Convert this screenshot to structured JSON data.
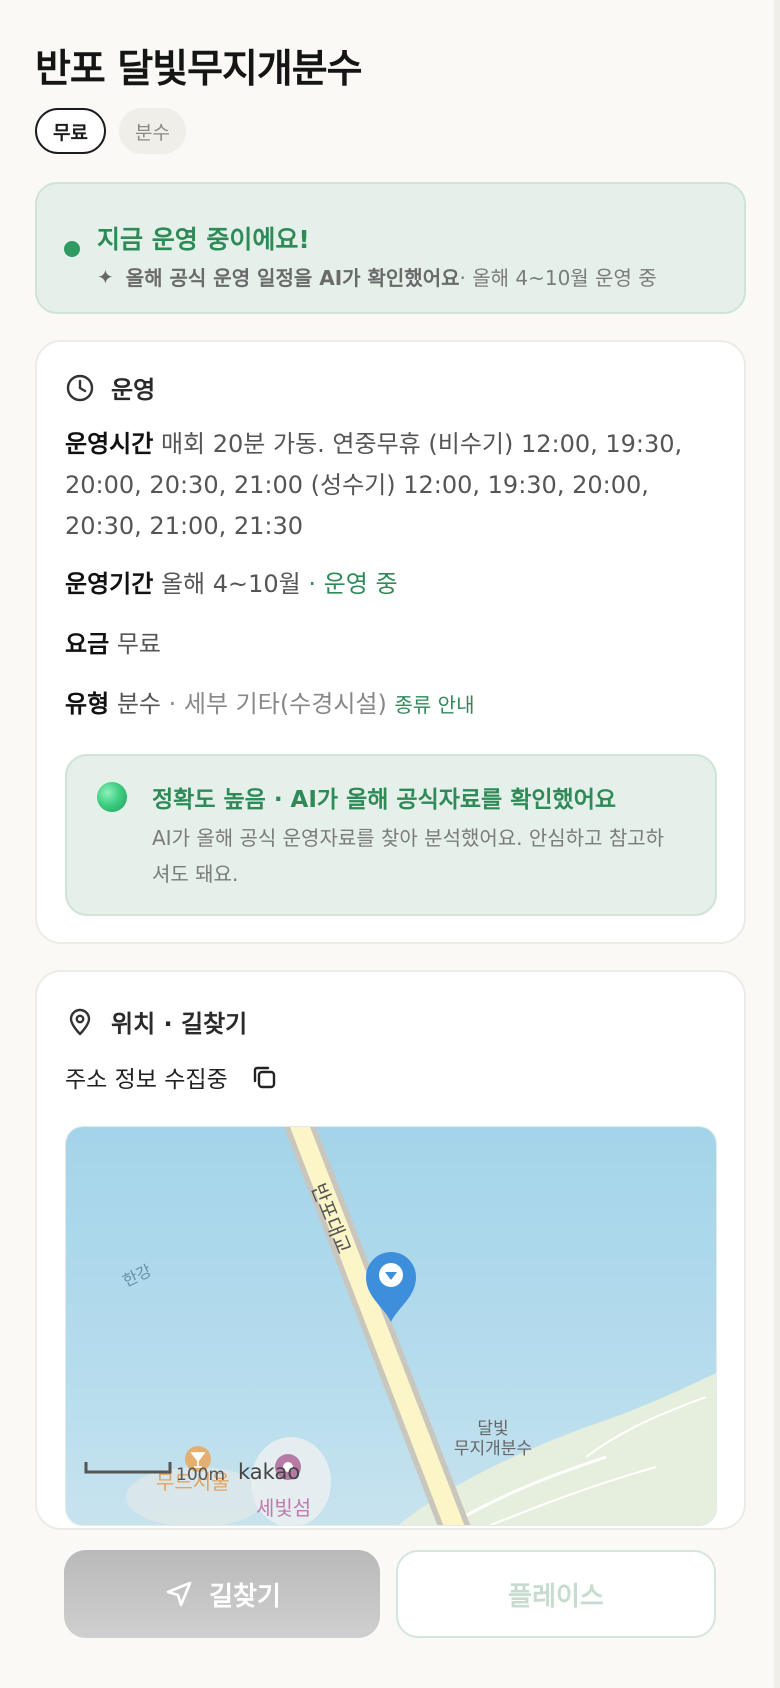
{
  "header": {
    "title": "반포 달빛무지개분수",
    "tags": [
      "무료",
      "분수"
    ]
  },
  "status": {
    "title": "지금 운영 중이에요!",
    "sub_bold": "올해 공식 운영 일정을 AI가 확인했어요",
    "sub_rest": " · 올해 4~10월 운영 중",
    "sparkle_icon": "sparkle-icon",
    "accent": "#2e8a57"
  },
  "operation": {
    "section_title": "운영",
    "hours_label": "운영시간",
    "hours_value": "매회 20분 가동. 연중무휴 (비수기) 12:00, 19:30, 20:00, 20:30, 21:00 (성수기) 12:00, 19:30, 20:00, 20:30, 21:00, 21:30",
    "period_label": "운영기간",
    "period_value": "올해 4~10월",
    "period_status": " · 운영 중",
    "fee_label": "요금",
    "fee_value": "무료",
    "type_label": "유형",
    "type_value": "분수",
    "type_detail": " · 세부 기타(수경시설)",
    "type_link": "종류 안내",
    "accuracy_title": "정확도 높음 · AI가 올해 공식자료를 확인했어요",
    "accuracy_body": "AI가 올해 공식 운영자료를 찾아 분석했어요. 안심하고 참고하셔도 돼요."
  },
  "location": {
    "section_title": "위치 · 길찾기",
    "address": "주소 정보 수집중",
    "map": {
      "river_label": "한강",
      "bridge_label": "반포대교",
      "place_label_1": "달빛",
      "place_label_2": "무지개분수",
      "poi_label_1": "무드서울",
      "poi_label_2": "세빛섬",
      "scale_label": "100m",
      "provider": "kakao"
    }
  },
  "actions": {
    "route_label": "길찾기",
    "place_label": "플레이스"
  }
}
